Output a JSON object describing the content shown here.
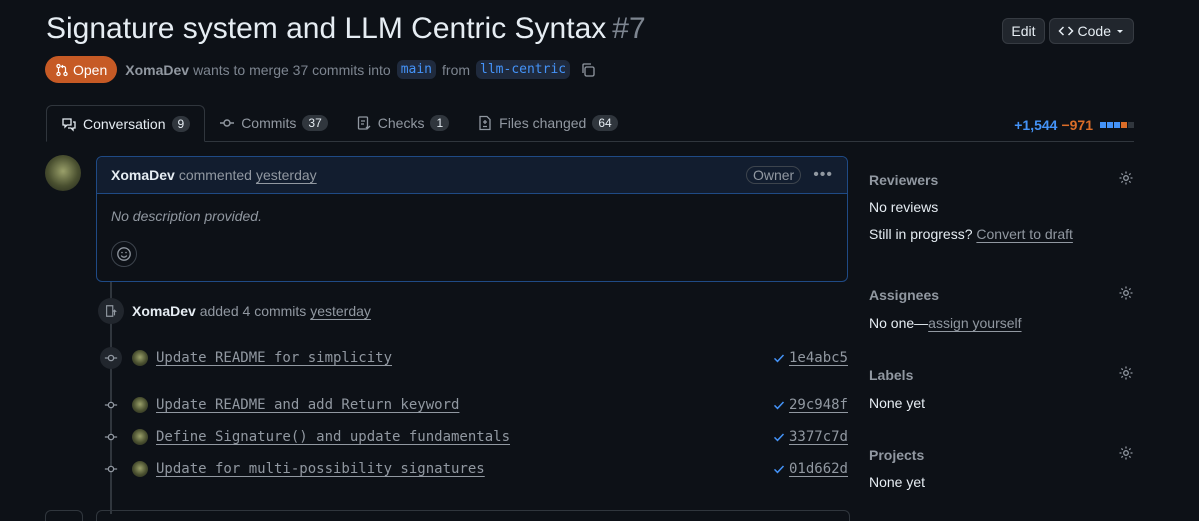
{
  "pr": {
    "title": "Signature system and LLM Centric Syntax",
    "number": "#7",
    "state": "Open",
    "author": "XomaDev",
    "merge_text": "wants to merge 37 commits into",
    "base_branch": "main",
    "from_text": "from",
    "head_branch": "llm-centric"
  },
  "header_buttons": {
    "edit": "Edit",
    "code": "Code"
  },
  "tabs": [
    {
      "label": "Conversation",
      "count": "9"
    },
    {
      "label": "Commits",
      "count": "37"
    },
    {
      "label": "Checks",
      "count": "1"
    },
    {
      "label": "Files changed",
      "count": "64"
    }
  ],
  "diffstat": {
    "additions": "+1,544",
    "deletions": "−971"
  },
  "comment": {
    "author": "XomaDev",
    "action": "commented",
    "time": "yesterday",
    "role": "Owner",
    "body": "No description provided."
  },
  "event": {
    "author": "XomaDev",
    "text": "added 4 commits",
    "time": "yesterday"
  },
  "commits": [
    {
      "message": "Update README for simplicity",
      "sha": "1e4abc5"
    },
    {
      "message": "Update README and add Return keyword",
      "sha": "29c948f"
    },
    {
      "message": "Define Signature() and update fundamentals",
      "sha": "3377c7d"
    },
    {
      "message": "Update for multi-possibility signatures",
      "sha": "01d662d"
    }
  ],
  "sidebar": {
    "reviewers": {
      "title": "Reviewers",
      "value": "No reviews",
      "progress_text": "Still in progress?",
      "progress_link": "Convert to draft"
    },
    "assignees": {
      "title": "Assignees",
      "value": "No one—",
      "link": "assign yourself"
    },
    "labels": {
      "title": "Labels",
      "value": "None yet"
    },
    "projects": {
      "title": "Projects",
      "value": "None yet"
    }
  },
  "colors": {
    "open_state": "#c65a25",
    "additions": "#4493f8",
    "deletions": "#db6d28",
    "accent_border": "#1f4a85"
  }
}
